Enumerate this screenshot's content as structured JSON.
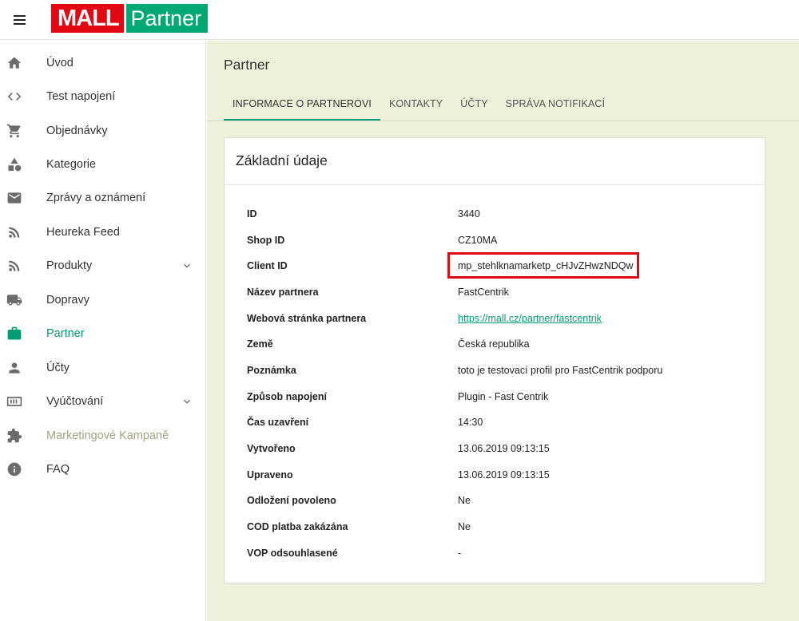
{
  "header": {
    "logo_mall": "MALL",
    "logo_partner": "Partner"
  },
  "sidebar": {
    "items": [
      {
        "label": "Úvod",
        "icon": "home-icon"
      },
      {
        "label": "Test napojení",
        "icon": "code-icon"
      },
      {
        "label": "Objednávky",
        "icon": "cart-icon"
      },
      {
        "label": "Kategorie",
        "icon": "category-icon"
      },
      {
        "label": "Zprávy a oznámení",
        "icon": "mail-icon"
      },
      {
        "label": "Heureka Feed",
        "icon": "rss-icon"
      },
      {
        "label": "Produkty",
        "icon": "rss-icon",
        "expandable": true
      },
      {
        "label": "Dopravy",
        "icon": "truck-icon"
      },
      {
        "label": "Partner",
        "icon": "briefcase-icon",
        "active": true
      },
      {
        "label": "Účty",
        "icon": "person-icon"
      },
      {
        "label": "Vyúčtování",
        "icon": "money-icon",
        "expandable": true
      },
      {
        "label": "Marketingové Kampaně",
        "icon": "puzzle-icon",
        "disabled": true
      },
      {
        "label": "FAQ",
        "icon": "info-icon"
      }
    ]
  },
  "main": {
    "title": "Partner",
    "tabs": [
      {
        "label": "INFORMACE O PARTNEROVI",
        "active": true
      },
      {
        "label": "KONTAKTY"
      },
      {
        "label": "ÚČTY"
      },
      {
        "label": "SPRÁVA NOTIFIKACÍ"
      }
    ],
    "card": {
      "title": "Základní údaje",
      "rows": [
        {
          "label": "ID",
          "value": "3440"
        },
        {
          "label": "Shop ID",
          "value": "CZ10MA"
        },
        {
          "label": "Client ID",
          "value": "mp_stehlknamarketp_cHJvZHwzNDQw"
        },
        {
          "label": "Název partnera",
          "value": "FastCentrik"
        },
        {
          "label": "Webová stránka partnera",
          "value": "https://mall.cz/partner/fastcentrik",
          "link": true
        },
        {
          "label": "Země",
          "value": "Česká republika"
        },
        {
          "label": "Poznámka",
          "value": "toto je testovací profil pro FastCentrik podporu"
        },
        {
          "label": "Způsob napojení",
          "value": "Plugin - Fast Centrik"
        },
        {
          "label": "Čas uzavření",
          "value": "14:30"
        },
        {
          "label": "Vytvořeno",
          "value": "13.06.2019 09:13:15"
        },
        {
          "label": "Upraveno",
          "value": "13.06.2019 09:13:15"
        },
        {
          "label": "Odložení povoleno",
          "value": "Ne"
        },
        {
          "label": "COD platba zakázána",
          "value": "Ne"
        },
        {
          "label": "VOP odsouhlasené",
          "value": "-"
        }
      ]
    }
  },
  "colors": {
    "accent": "#009c73",
    "brand_red": "#e30613",
    "brand_green": "#00a874",
    "main_bg": "#eef0da",
    "icon_gray": "#6b6b6b",
    "muted_text": "#a7a283",
    "highlight": "#e30613"
  }
}
